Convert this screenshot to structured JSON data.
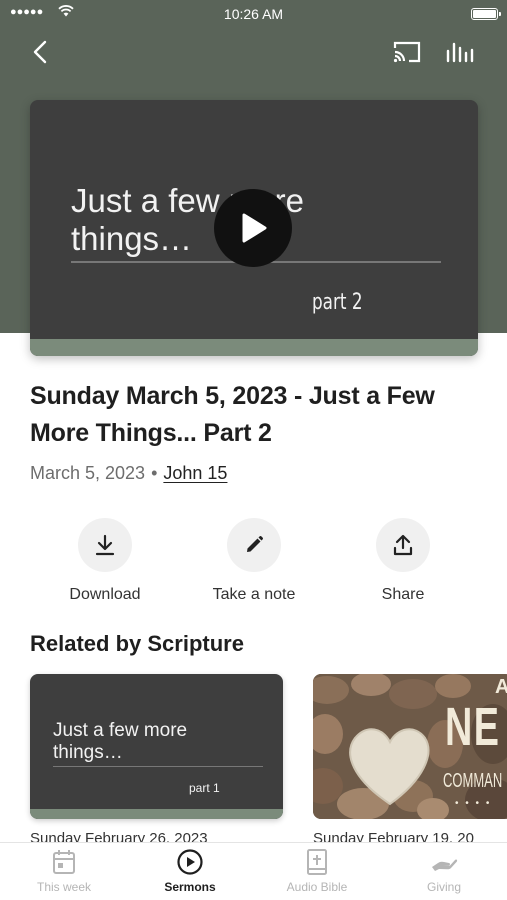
{
  "status_bar": {
    "time": "10:26 AM",
    "signal": "●●●●●"
  },
  "header": {
    "back_icon": "chevron-left-icon",
    "cast_icon": "cast-icon",
    "equalizer_icon": "equalizer-icon"
  },
  "artwork": {
    "title": "Just a few more things…",
    "part": "part 2",
    "play_icon": "play-icon",
    "colors": {
      "background": "#3e3e3e",
      "strip": "#7b8b7b",
      "hero": "#5a6459"
    }
  },
  "sermon": {
    "title": "Sunday March 5, 2023 - Just a Few More Things... Part 2",
    "date": "March 5, 2023",
    "separator": "•",
    "scripture": "John 15"
  },
  "actions": [
    {
      "label": "Download",
      "icon": "download-icon"
    },
    {
      "label": "Take a note",
      "icon": "pencil-icon"
    },
    {
      "label": "Share",
      "icon": "share-icon"
    }
  ],
  "related": {
    "heading": "Related by Scripture",
    "cards": [
      {
        "art_title": "Just a few more things…",
        "art_part": "part 1",
        "caption": "Sunday February 26, 2023"
      },
      {
        "art_letter": "A",
        "art_word": "NE",
        "art_sub": "COMMAN",
        "art_dots": "• • • •",
        "caption": "Sunday February 19, 20"
      }
    ]
  },
  "tabs": [
    {
      "label": "This week",
      "icon": "calendar-icon",
      "active": false
    },
    {
      "label": "Sermons",
      "icon": "play-circle-icon",
      "active": true
    },
    {
      "label": "Audio Bible",
      "icon": "bible-icon",
      "active": false
    },
    {
      "label": "Giving",
      "icon": "giving-hand-icon",
      "active": false
    }
  ]
}
